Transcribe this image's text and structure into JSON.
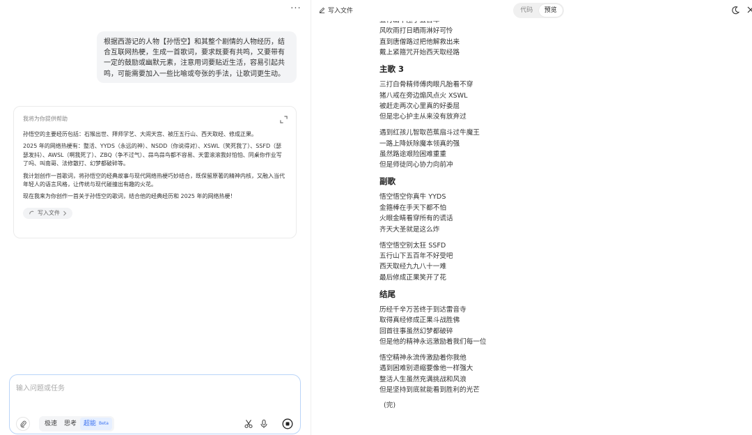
{
  "chat": {
    "more_label": "···",
    "user_message": "根据西游记的人物【孙悟空】和其整个剧情的人物经历，结合互联网热梗，生成一首歌词，要求既要有共鸣，又要带有一定的鼓励或幽默元素，注意用词要贴近生活，容易引起共鸣，可能需要加入一些比喻或夸张的手法，让歌词更生动。",
    "assistant": {
      "header": "我将为你提供帮助",
      "paragraphs": [
        "孙悟空的主要经历包括：石猴出世、拜师学艺、大闹天宫、被压五行山、西天取经、修成正果。",
        "2025 年的网络热梗有：整活、YYDS（永远的神）、NSDD（你说得对）、XSWL（笑死我了）、SSFD（瑟瑟发抖）、AWSL（啊我死了）、ZBQ（争不过气）、蒜鸟蒜鸟都不容易、天雷滚滚我好怕怕、同桌你作业写了吗、叫南哥、法修散打、幻梦都破碎等。",
        "我计划创作一首歌词，将孙悟空的经典故事与现代网络热梗巧妙结合，既保留原著的精神内核，又融入当代年轻人的语言风格，让传统与现代碰撞出有趣的火花。",
        "现在我来为你创作一首关于孙悟空的歌词，结合他的经典经历和 2025 年的网络热梗！"
      ],
      "chip_label": "写入文件"
    }
  },
  "composer": {
    "placeholder": "输入问题或任务",
    "modes": [
      "极速",
      "思考",
      "超能"
    ],
    "beta_label": "Beta"
  },
  "preview": {
    "file_title": "写入文件",
    "toggle": [
      "代码",
      "预览"
    ],
    "top_partial_lines": [
      "五行山下压了五百年",
      "风吹雨打日晒雨淋好可怜",
      "直到唐僧路过把他解救出来",
      "戴上紧箍咒开始西天取经路"
    ],
    "sections": [
      {
        "heading": "主歌 3",
        "stanzas": [
          [
            "三打白骨精师傅肉眼凡胎看不穿",
            "猪八戒在旁边煽风点火 XSWL",
            "被赶走两次心里真的好委屈",
            "但是忠心护主从来没有放弃过"
          ],
          [
            "遇到红孩儿智取芭蕉扇斗过牛魔王",
            "一路上降妖除魔本领真的强",
            "虽然路途艰险困难重重",
            "但是师徒同心协力向前冲"
          ]
        ]
      },
      {
        "heading": "副歌",
        "stanzas": [
          [
            "悟空悟空你真牛 YYDS",
            "金箍棒在手天下都不怕",
            "火眼金睛看穿所有的谎话",
            "齐天大圣就是这么炸"
          ],
          [
            "悟空悟空别太狂 SSFD",
            "五行山下五百年不好受吧",
            "西天取经九九八十一难",
            "最后修成正果笑开了花"
          ]
        ]
      },
      {
        "heading": "结尾",
        "stanzas": [
          [
            "历经千辛万苦终于到达雷音寺",
            "取得真经修成正果斗战胜佛",
            "回首往事虽然幻梦都破碎",
            "但是他的精神永远激励着我们每一位"
          ],
          [
            "悟空精神永流传激励着你我他",
            "遇到困难别退缩要像他一样强大",
            "整活人生虽然充满挑战和风浪",
            "但是坚持到底就能看到胜利的光芒"
          ]
        ]
      }
    ],
    "end_text": "(完)"
  }
}
